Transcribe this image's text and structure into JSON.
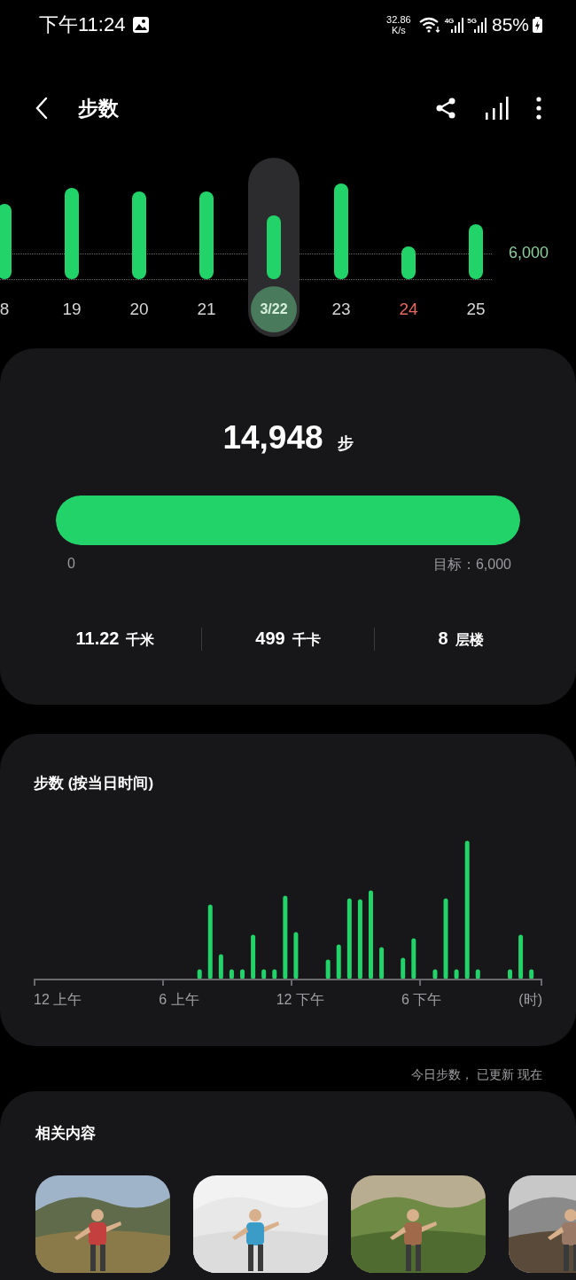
{
  "status_bar": {
    "time": "下午11:24",
    "speed_value": "32.86",
    "speed_unit": "K/s",
    "network_1": "4G",
    "network_2": "5G",
    "battery": "85%"
  },
  "header": {
    "title": "步数"
  },
  "days": [
    {
      "label": "8",
      "selected": false,
      "sunday": false
    },
    {
      "label": "19",
      "selected": false,
      "sunday": false
    },
    {
      "label": "20",
      "selected": false,
      "sunday": false
    },
    {
      "label": "21",
      "selected": false,
      "sunday": false
    },
    {
      "label": "3/22",
      "selected": true,
      "sunday": false
    },
    {
      "label": "23",
      "selected": false,
      "sunday": false
    },
    {
      "label": "24",
      "selected": false,
      "sunday": true
    },
    {
      "label": "25",
      "selected": false,
      "sunday": false
    }
  ],
  "goal_line_label": "6,000",
  "summary": {
    "steps": "14,948",
    "unit": "步",
    "level": 1,
    "start_label": "0",
    "goal_label": "目标：6,000",
    "stats": [
      {
        "value": "11.22",
        "unit": "千米"
      },
      {
        "value": "499",
        "unit": "千卡"
      },
      {
        "value": "8",
        "unit": "层楼"
      }
    ]
  },
  "hourly": {
    "title": "步数 (按当日时间)",
    "axis_labels": [
      "12 上午",
      "6 上午",
      "12 下午",
      "6 下午",
      "(时)"
    ]
  },
  "updated_note": "今日步数， 已更新 现在",
  "related": {
    "title": "相关内容"
  }
}
